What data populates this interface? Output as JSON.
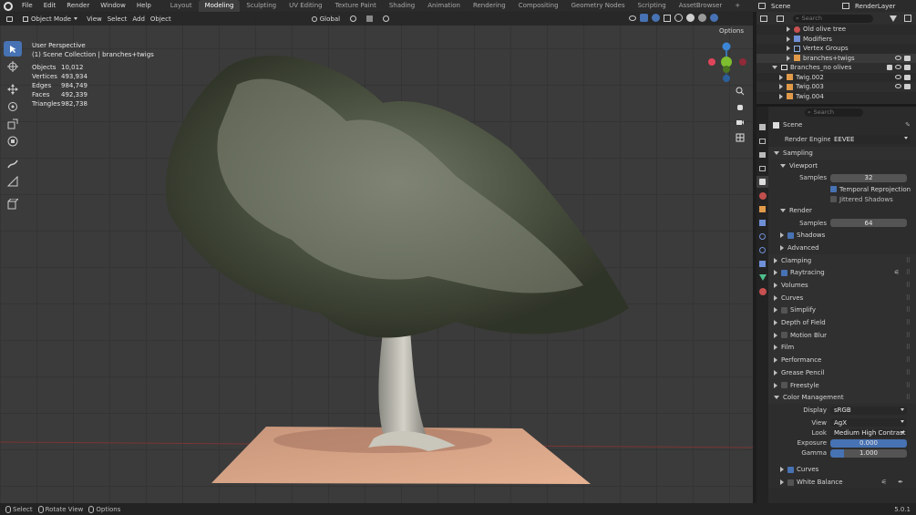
{
  "topbar": {
    "menus": [
      "File",
      "Edit",
      "Render",
      "Window",
      "Help"
    ],
    "workspaces": [
      "Layout",
      "Modeling",
      "Sculpting",
      "UV Editing",
      "Texture Paint",
      "Shading",
      "Animation",
      "Rendering",
      "Compositing",
      "Geometry Nodes",
      "Scripting",
      "AssetBrowser"
    ],
    "active_workspace": "Modeling",
    "add_tab": "+",
    "scene_name": "Scene",
    "view_layer": "RenderLayer"
  },
  "viewport": {
    "mode": "Object Mode",
    "menus": [
      "View",
      "Select",
      "Add",
      "Object"
    ],
    "orientation": "Global",
    "options_label": "Options",
    "view_name": "User Perspective",
    "collection_path": "(1) Scene Collection | branches+twigs",
    "stats": [
      {
        "key": "Objects",
        "value": "10,012"
      },
      {
        "key": "Vertices",
        "value": "493,934"
      },
      {
        "key": "Edges",
        "value": "984,749"
      },
      {
        "key": "Faces",
        "value": "492,339"
      },
      {
        "key": "Triangles",
        "value": "982,738"
      }
    ]
  },
  "outliner": {
    "search_placeholder": "Search",
    "rows": [
      {
        "label": "Old olive tree",
        "indent": 3
      },
      {
        "label": "Modifiers",
        "indent": 3
      },
      {
        "label": "Vertex Groups",
        "indent": 3
      },
      {
        "label": "branches+twigs",
        "indent": 3
      },
      {
        "label": "Branches_no olives",
        "indent": 1
      },
      {
        "label": "Twig.002",
        "indent": 2
      },
      {
        "label": "Twig.003",
        "indent": 2
      },
      {
        "label": "Twig.004",
        "indent": 2
      }
    ]
  },
  "properties": {
    "search_placeholder": "Search",
    "scene_label": "Scene",
    "render_engine_label": "Render Engine",
    "render_engine": "EEVEE",
    "sampling": "Sampling",
    "viewport": "Viewport",
    "samples_label": "Samples",
    "viewport_samples": "32",
    "temporal_reprojection": "Temporal Reprojection",
    "jittered_shadows": "Jittered Shadows",
    "render": "Render",
    "render_samples": "64",
    "shadows": "Shadows",
    "advanced": "Advanced",
    "clamping": "Clamping",
    "raytracing": "Raytracing",
    "volumes": "Volumes",
    "curves": "Curves",
    "simplify": "Simplify",
    "depth_of_field": "Depth of Field",
    "motion_blur": "Motion Blur",
    "film": "Film",
    "performance": "Performance",
    "grease_pencil": "Grease Pencil",
    "freestyle": "Freestyle",
    "color_management": "Color Management",
    "display_label": "Display",
    "display_value": "sRGB",
    "view_label": "View",
    "view_value": "AgX",
    "look_label": "Look",
    "look_value": "Medium High Contrast",
    "exposure_label": "Exposure",
    "exposure_value": "0.000",
    "gamma_label": "Gamma",
    "gamma_value": "1.000",
    "cm_curves": "Curves",
    "white_balance": "White Balance"
  },
  "statusbar": {
    "select": "Select",
    "rotate_view": "Rotate View",
    "options": "Options",
    "version": "5.0.1"
  },
  "colors": {
    "accent": "#4772b3",
    "x_axis": "#e0455a",
    "y_axis": "#7dbd2f",
    "z_axis": "#3b86d6"
  }
}
